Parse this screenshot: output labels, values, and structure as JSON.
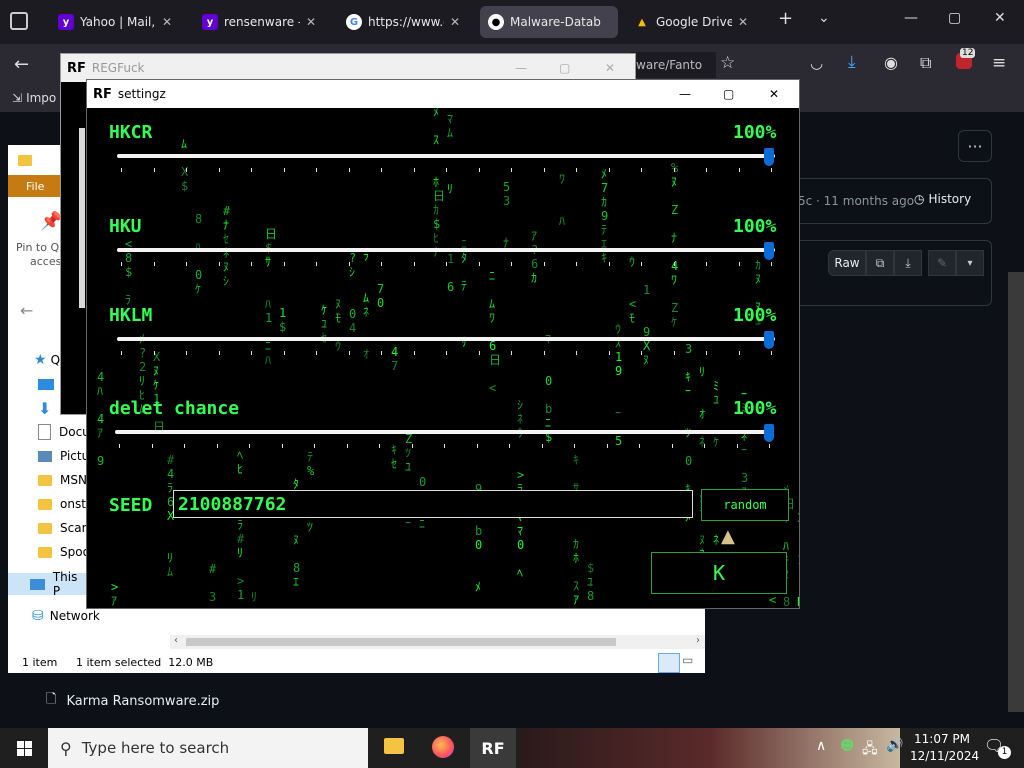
{
  "browser": {
    "tabs": [
      {
        "label": "Yahoo | Mail, We",
        "icon": "yahoo-icon"
      },
      {
        "label": "rensenware - Yah",
        "icon": "yahoo-icon"
      },
      {
        "label": "https://www.go",
        "icon": "google-icon"
      },
      {
        "label": "Malware-Datab",
        "icon": "github-icon",
        "active": true
      },
      {
        "label": "Google Drive - W",
        "icon": "drive-icon"
      }
    ],
    "url_fragment": "ware/Fanto",
    "bookmark_label": "Impo",
    "extension_badge": "12"
  },
  "github": {
    "commit_text": "5c · 11 months ago",
    "history_label": "History",
    "raw_label": "Raw"
  },
  "explorer": {
    "file_tab": "File",
    "pin_label": "Pin to Qu",
    "access_label": "access",
    "sidebar": [
      "Docu",
      "Pictu",
      "MSN",
      "onst",
      "Scary",
      "Spoo"
    ],
    "this_pc": "This P",
    "network": "Network",
    "status_items": "1 item",
    "status_selected": "1 item selected  12.0 MB",
    "below_file": "Karma Ransomware.zip"
  },
  "regfuck": {
    "title": "REGFuck"
  },
  "settingz": {
    "title": "settingz",
    "sliders": [
      {
        "label": "HKCR",
        "percent_text": "100%",
        "value": 1.0
      },
      {
        "label": "HKU",
        "percent_text": "100%",
        "value": 1.0
      },
      {
        "label": "HKLM",
        "percent_text": "100%",
        "value": 1.0
      },
      {
        "label": "delet chance",
        "percent_text": "100%",
        "value": 1.0
      }
    ],
    "seed_label": "SEED",
    "seed_value": "2100887762",
    "random_label": "random",
    "ok_label": "K"
  },
  "taskbar": {
    "search_placeholder": "Type here to search",
    "time": "11:07 PM",
    "date": "12/11/2024",
    "notification_count": "1"
  },
  "colors": {
    "matrix_green": "#33ff55",
    "slider_blue": "#0b6cd8"
  }
}
